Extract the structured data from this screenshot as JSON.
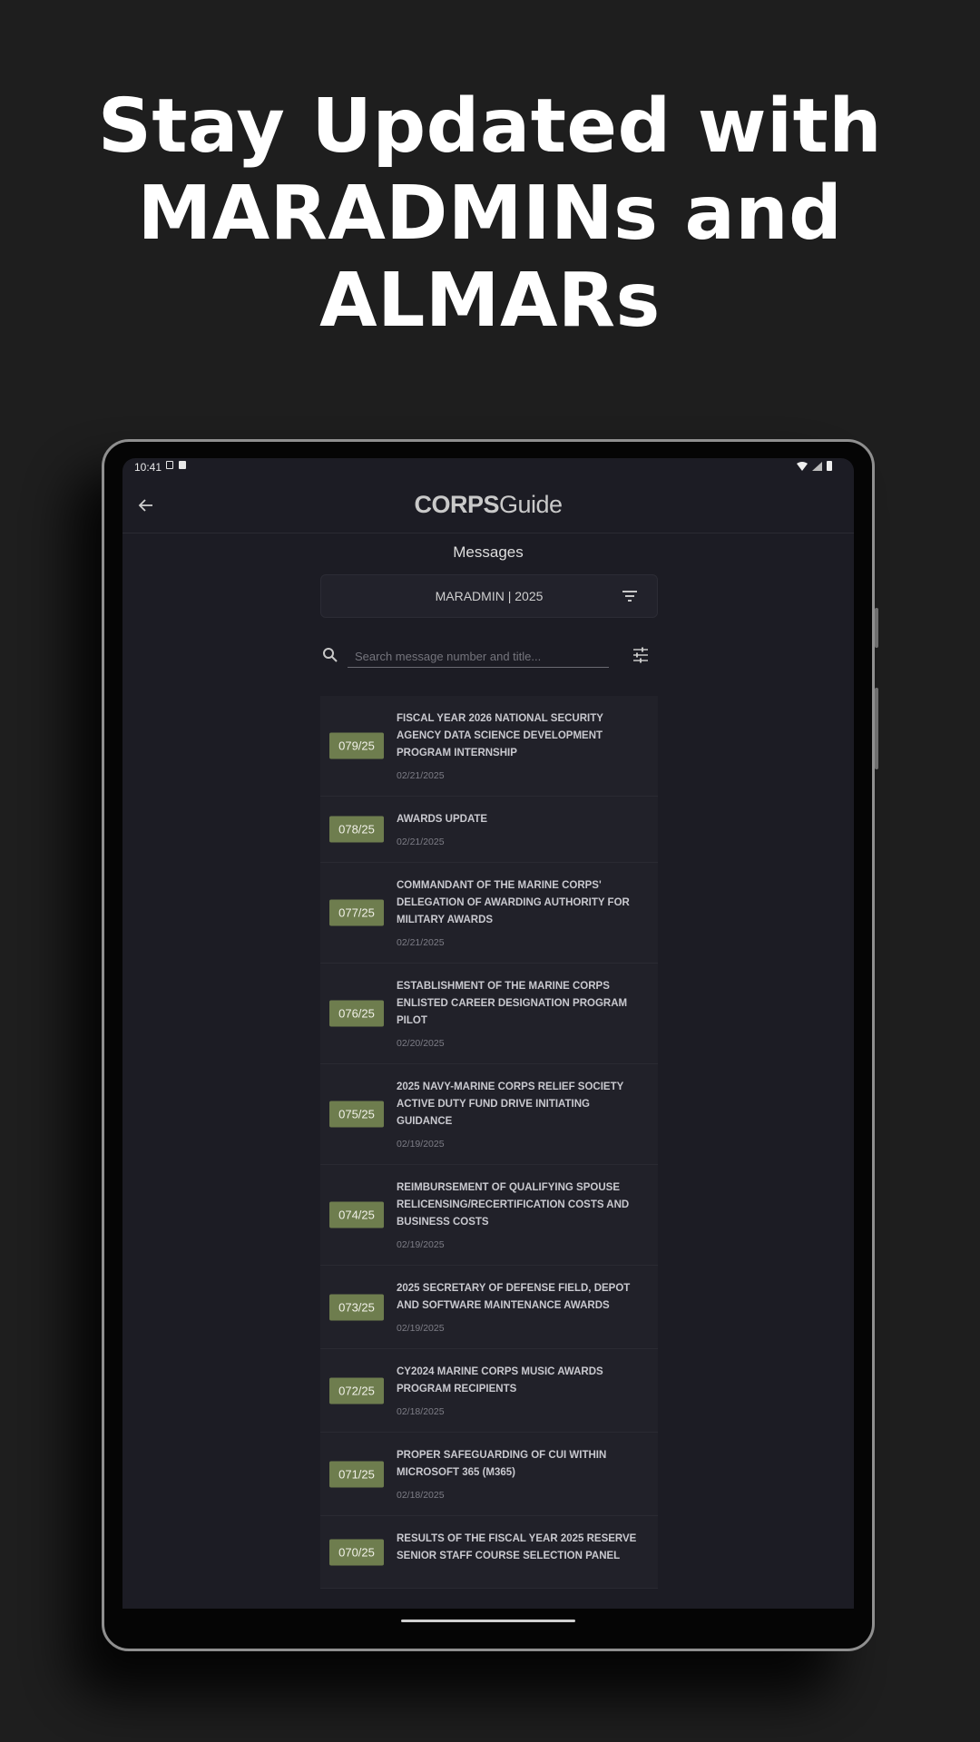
{
  "promo": {
    "headline_lines": [
      "Stay Updated with",
      "MARADMINs and",
      "ALMARs"
    ]
  },
  "status_bar": {
    "time": "10:41"
  },
  "app_bar": {
    "back_icon": "arrow-left-icon",
    "logo_strong": "CORPS",
    "logo_light": "Guide"
  },
  "page": {
    "title": "Messages"
  },
  "filter": {
    "label": "MARADMIN | 2025",
    "icon": "filter-icon"
  },
  "search": {
    "placeholder": "Search message number and title..."
  },
  "messages": [
    {
      "number": "079/25",
      "title": "FISCAL YEAR 2026 NATIONAL SECURITY AGENCY DATA SCIENCE  DEVELOPMENT PROGRAM INTERNSHIP",
      "date": "02/21/2025"
    },
    {
      "number": "078/25",
      "title": "AWARDS UPDATE",
      "date": "02/21/2025"
    },
    {
      "number": "077/25",
      "title": "COMMANDANT OF THE MARINE CORPS' DELEGATION OF AWARDING  AUTHORITY FOR MILITARY AWARDS",
      "date": "02/21/2025"
    },
    {
      "number": "076/25",
      "title": "ESTABLISHMENT OF THE MARINE CORPS ENLISTED  CAREER DESIGNATION PROGRAM PILOT",
      "date": "02/20/2025"
    },
    {
      "number": "075/25",
      "title": "2025 NAVY-MARINE CORPS RELIEF SOCIETY ACTIVE DUTY FUND DRIVE INITIATING GUIDANCE",
      "date": "02/19/2025"
    },
    {
      "number": "074/25",
      "title": "REIMBURSEMENT OF QUALIFYING SPOUSE RELICENSING/RECERTIFICATION COSTS AND BUSINESS COSTS",
      "date": "02/19/2025"
    },
    {
      "number": "073/25",
      "title": "2025 SECRETARY OF DEFENSE FIELD, DEPOT AND SOFTWARE  MAINTENANCE AWARDS",
      "date": "02/19/2025"
    },
    {
      "number": "072/25",
      "title": "CY2024 MARINE CORPS MUSIC AWARDS PROGRAM RECIPIENTS",
      "date": "02/18/2025"
    },
    {
      "number": "071/25",
      "title": "PROPER SAFEGUARDING OF CUI WITHIN MICROSOFT 365 (M365)",
      "date": "02/18/2025"
    },
    {
      "number": "070/25",
      "title": "RESULTS OF THE FISCAL YEAR 2025 RESERVE SENIOR STAFF COURSE  SELECTION PANEL",
      "date": ""
    }
  ],
  "colors": {
    "background": "#1e1e1e",
    "screen": "#1c1c24",
    "badge": "#6e7d4e"
  }
}
